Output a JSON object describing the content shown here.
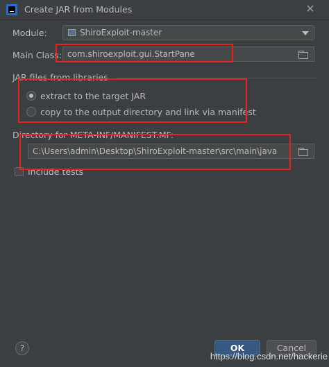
{
  "window": {
    "title": "Create JAR from Modules"
  },
  "module": {
    "label": "Module:",
    "value": "ShiroExploit-master"
  },
  "main_class": {
    "label": "Main Class:",
    "value": "com.shiroexploit.gui.StartPane"
  },
  "jar_files": {
    "section_title": "JAR files from libraries",
    "options": [
      {
        "label": "extract to the target JAR",
        "selected": true
      },
      {
        "label": "copy to the output directory and link via manifest",
        "selected": false
      }
    ]
  },
  "manifest": {
    "label": "Directory for META-INF/MANIFEST.MF:",
    "value": "C:\\Users\\admin\\Desktop\\ShiroExploit-master\\src\\main\\java"
  },
  "include_tests": {
    "label": "Include tests",
    "checked": false
  },
  "buttons": {
    "help": "?",
    "ok": "OK",
    "cancel": "Cancel"
  },
  "watermark": "https://blog.csdn.net/hackerie",
  "colors": {
    "background": "#3c3f41",
    "highlight": "#e8231a",
    "ok_button": "#365880"
  },
  "icons": [
    "app-icon",
    "close-icon",
    "module-icon",
    "chevron-down-icon",
    "folder-icon",
    "help-icon"
  ]
}
